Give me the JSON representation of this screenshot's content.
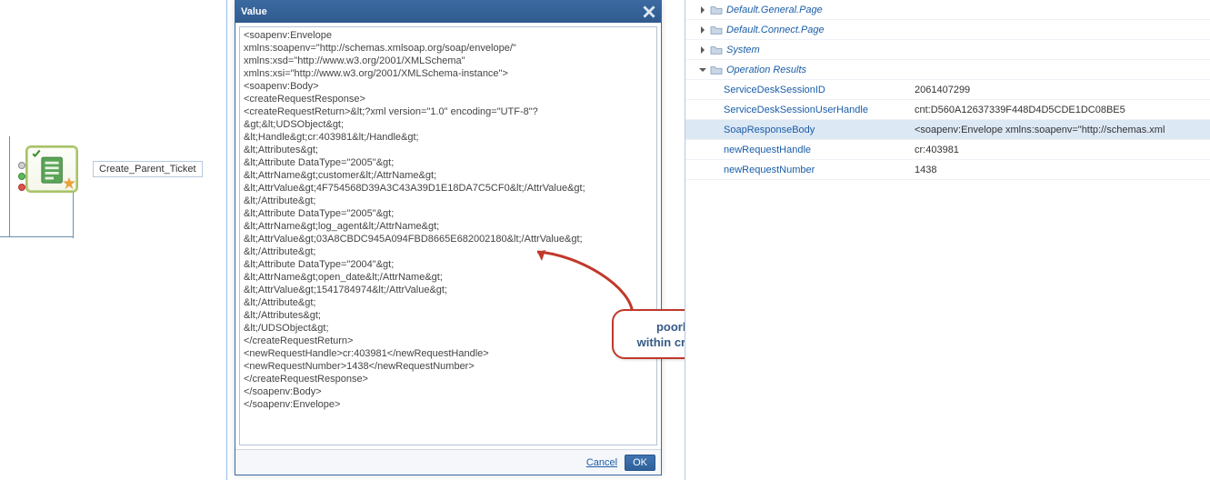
{
  "canvas": {
    "node_label": "Create_Parent_Ticket"
  },
  "dialog": {
    "title": "Value",
    "cancel_label": "Cancel",
    "ok_label": "OK",
    "xml_content": "<soapenv:Envelope\nxmlns:soapenv=\"http://schemas.xmlsoap.org/soap/envelope/\"\nxmlns:xsd=\"http://www.w3.org/2001/XMLSchema\"\nxmlns:xsi=\"http://www.w3.org/2001/XMLSchema-instance\">\n<soapenv:Body>\n<createRequestResponse>\n<createRequestReturn>&lt;?xml version=\"1.0\" encoding=\"UTF-8\"?\n&gt;&lt;UDSObject&gt;\n&lt;Handle&gt;cr:403981&lt;/Handle&gt;\n&lt;Attributes&gt;\n&lt;Attribute DataType=\"2005\"&gt;\n&lt;AttrName&gt;customer&lt;/AttrName&gt;\n&lt;AttrValue&gt;4F754568D39A3C43A39D1E18DA7C5CF0&lt;/AttrValue&gt;\n&lt;/Attribute&gt;\n&lt;Attribute DataType=\"2005\"&gt;\n&lt;AttrName&gt;log_agent&lt;/AttrName&gt;\n&lt;AttrValue&gt;03A8CBDC945A094FBD8665E682002180&lt;/AttrValue&gt;\n&lt;/Attribute&gt;\n&lt;Attribute DataType=\"2004\"&gt;\n&lt;AttrName&gt;open_date&lt;/AttrName&gt;\n&lt;AttrValue&gt;1541784974&lt;/AttrValue&gt;\n&lt;/Attribute&gt;\n&lt;/Attributes&gt;\n&lt;/UDSObject&gt;\n</createRequestReturn>\n<newRequestHandle>cr:403981</newRequestHandle>\n<newRequestNumber>1438</newRequestNumber>\n</createRequestResponse>\n</soapenv:Body>\n</soapenv:Envelope>"
  },
  "callout": {
    "line1": "poorly formated XML",
    "line2": "within createRequestReturn"
  },
  "tree": {
    "groups": [
      {
        "label": "Default.General.Page",
        "expanded": false,
        "indent": 10
      },
      {
        "label": "Default.Connect.Page",
        "expanded": false,
        "indent": 10
      },
      {
        "label": "System",
        "expanded": false,
        "indent": 10
      },
      {
        "label": "Operation Results",
        "expanded": true,
        "indent": 10
      }
    ],
    "results": [
      {
        "key": "ServiceDeskSessionID",
        "value": "2061407299",
        "selected": false
      },
      {
        "key": "ServiceDeskSessionUserHandle",
        "value": "cnt:D560A12637339F448D4D5CDE1DC08BE5",
        "selected": false
      },
      {
        "key": "SoapResponseBody",
        "value": "<soapenv:Envelope xmlns:soapenv=\"http://schemas.xml",
        "selected": true
      },
      {
        "key": "newRequestHandle",
        "value": "cr:403981",
        "selected": false
      },
      {
        "key": "newRequestNumber",
        "value": "1438",
        "selected": false
      }
    ]
  }
}
